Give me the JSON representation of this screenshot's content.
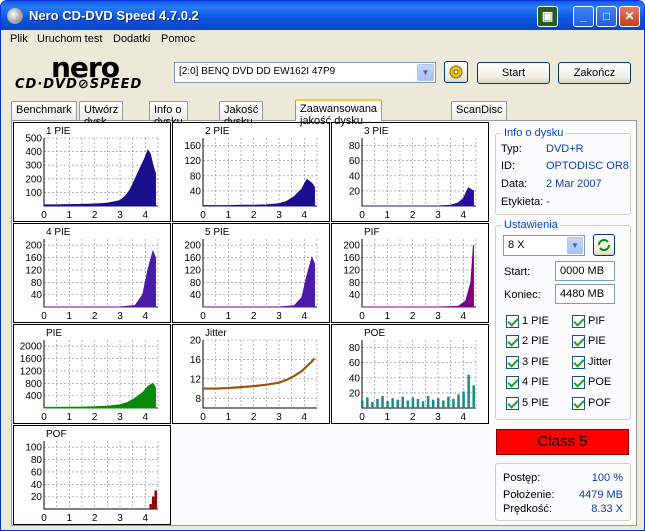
{
  "window": {
    "title": "Nero CD-DVD Speed 4.7.0.2",
    "minimize_label": "_",
    "maximize_label": "□",
    "close_label": "✕"
  },
  "menu": [
    "Plik",
    "Uruchom test",
    "Dodatki",
    "Pomoc"
  ],
  "logo": {
    "brand": "nero",
    "product": "CD·DVD⊘SPEED"
  },
  "toolbar": {
    "drive": "[2:0]   BENQ DVD DD EW162I 47P9",
    "start_label": "Start",
    "exit_label": "Zakończ"
  },
  "tabs": [
    "Benchmark",
    "Utwórz dysk",
    "Info o dysku",
    "Jakość dysku",
    "Zaawansowana jakość dysku",
    "ScanDisc"
  ],
  "active_tab": 4,
  "disc_info": {
    "title": "Info o dysku",
    "type_label": "Typ:",
    "type_value": "DVD+R",
    "id_label": "ID:",
    "id_value": "OPTODISC OR8",
    "date_label": "Data:",
    "date_value": "2 Mar 2007",
    "label_label": "Etykieta:",
    "label_value": "-"
  },
  "settings": {
    "title": "Ustawienia",
    "speed": "8 X",
    "start_label": "Start:",
    "start_value": "0000 MB",
    "end_label": "Koniec:",
    "end_value": "4480 MB",
    "checks": [
      {
        "label": "1 PIE",
        "checked": true
      },
      {
        "label": "PIF",
        "checked": true
      },
      {
        "label": "2 PIE",
        "checked": true
      },
      {
        "label": "PIE",
        "checked": true
      },
      {
        "label": "3 PIE",
        "checked": true
      },
      {
        "label": "Jitter",
        "checked": true
      },
      {
        "label": "4 PIE",
        "checked": true
      },
      {
        "label": "POE",
        "checked": true
      },
      {
        "label": "5 PIE",
        "checked": true
      },
      {
        "label": "POF",
        "checked": true
      }
    ]
  },
  "class_result": {
    "text": "Class 5",
    "color": "#ff0000"
  },
  "progress": {
    "progress_label": "Postęp:",
    "progress_value": "100 %",
    "position_label": "Położenie:",
    "position_value": "4479 MB",
    "speed_label": "Prędkość:",
    "speed_value": "8.33 X"
  },
  "chart_data": [
    {
      "type": "area",
      "title": "1 PIE",
      "color": "#1a0f8c",
      "yticks": [
        "500",
        "400",
        "300",
        "200",
        "100"
      ],
      "ylim": [
        0,
        500
      ],
      "xticks": [
        "0",
        "1",
        "2",
        "3",
        "4"
      ],
      "xlim": [
        0,
        4.5
      ],
      "x": [
        0,
        0.5,
        1,
        1.5,
        2,
        2.5,
        3,
        3.2,
        3.4,
        3.6,
        3.8,
        4,
        4.1,
        4.2,
        4.3,
        4.4
      ],
      "y": [
        8,
        8,
        10,
        12,
        15,
        20,
        40,
        70,
        120,
        200,
        280,
        360,
        410,
        380,
        300,
        240
      ]
    },
    {
      "type": "area",
      "title": "2 PIE",
      "color": "#1a0f8c",
      "yticks": [
        "160",
        "120",
        "80",
        "40"
      ],
      "ylim": [
        0,
        180
      ],
      "xticks": [
        "0",
        "1",
        "2",
        "3",
        "4"
      ],
      "xlim": [
        0,
        4.5
      ],
      "x": [
        0,
        0.5,
        1,
        1.5,
        2,
        2.5,
        3,
        3.3,
        3.6,
        3.9,
        4.1,
        4.3,
        4.4
      ],
      "y": [
        1,
        1,
        1,
        2,
        2,
        3,
        6,
        12,
        25,
        45,
        70,
        60,
        50
      ]
    },
    {
      "type": "area",
      "title": "3 PIE",
      "color": "#2a0f9c",
      "yticks": [
        "80",
        "60",
        "40",
        "20"
      ],
      "ylim": [
        0,
        90
      ],
      "xticks": [
        "0",
        "1",
        "2",
        "3",
        "4"
      ],
      "xlim": [
        0,
        4.5
      ],
      "x": [
        0,
        1,
        2,
        3,
        3.5,
        3.8,
        4,
        4.2,
        4.4
      ],
      "y": [
        0,
        0,
        0,
        0,
        1,
        4,
        10,
        24,
        20
      ]
    },
    {
      "type": "area",
      "title": "4 PIE",
      "color": "#4a1aa8",
      "yticks": [
        "200",
        "160",
        "120",
        "80",
        "40"
      ],
      "ylim": [
        0,
        220
      ],
      "xticks": [
        "0",
        "1",
        "2",
        "3",
        "4"
      ],
      "xlim": [
        0,
        4.5
      ],
      "x": [
        0,
        1,
        2,
        3,
        3.6,
        3.9,
        4.1,
        4.3,
        4.4
      ],
      "y": [
        0,
        0,
        0,
        0,
        5,
        40,
        120,
        180,
        160
      ]
    },
    {
      "type": "area",
      "title": "5 PIE",
      "color": "#4a1aa8",
      "yticks": [
        "200",
        "160",
        "120",
        "80",
        "40"
      ],
      "ylim": [
        0,
        220
      ],
      "xticks": [
        "0",
        "1",
        "2",
        "3",
        "4"
      ],
      "xlim": [
        0,
        4.5
      ],
      "x": [
        0,
        1,
        2,
        3,
        3.6,
        3.9,
        4.1,
        4.3,
        4.4
      ],
      "y": [
        0,
        0,
        0,
        0,
        4,
        30,
        100,
        160,
        140
      ]
    },
    {
      "type": "area",
      "title": "PIF",
      "color": "#800080",
      "yticks": [
        "200",
        "160",
        "120",
        "80",
        "40"
      ],
      "ylim": [
        0,
        220
      ],
      "xticks": [
        "0",
        "1",
        "2",
        "3",
        "4"
      ],
      "xlim": [
        0,
        4.5
      ],
      "x": [
        0,
        1,
        2,
        3,
        3.8,
        4.1,
        4.3,
        4.4
      ],
      "y": [
        0,
        0,
        0,
        0,
        2,
        20,
        80,
        200
      ]
    },
    {
      "type": "area",
      "title": "PIE",
      "color": "#0a8a0a",
      "yticks": [
        "2000",
        "1600",
        "1200",
        "800",
        "400"
      ],
      "ylim": [
        0,
        2200
      ],
      "xticks": [
        "0",
        "1",
        "2",
        "3",
        "4"
      ],
      "xlim": [
        0,
        4.5
      ],
      "x": [
        0,
        0.5,
        1,
        1.5,
        2,
        2.5,
        3,
        3.3,
        3.6,
        3.9,
        4.1,
        4.3,
        4.4
      ],
      "y": [
        20,
        20,
        25,
        30,
        40,
        60,
        100,
        180,
        320,
        500,
        700,
        800,
        650
      ]
    },
    {
      "type": "line",
      "title": "Jitter",
      "color": "#a0500a",
      "yticks": [
        "20",
        "16",
        "12",
        "8"
      ],
      "ylim": [
        6,
        20
      ],
      "xticks": [
        "0",
        "1",
        "2",
        "3",
        "4"
      ],
      "xlim": [
        0,
        4.5
      ],
      "x": [
        0,
        0.5,
        1,
        1.5,
        2,
        2.5,
        3,
        3.3,
        3.6,
        3.9,
        4.1,
        4.3,
        4.4
      ],
      "y": [
        10,
        10,
        10.1,
        10.3,
        10.5,
        10.8,
        11.2,
        11.8,
        12.6,
        13.6,
        14.6,
        15.6,
        16.2
      ]
    },
    {
      "type": "bar",
      "title": "POE",
      "color": "#1a8a8a",
      "yticks": [
        "80",
        "60",
        "40",
        "20"
      ],
      "ylim": [
        0,
        90
      ],
      "xticks": [
        "0",
        "1",
        "2",
        "3",
        "4"
      ],
      "xlim": [
        0,
        4.5
      ],
      "x": [
        0,
        0.2,
        0.4,
        0.6,
        0.8,
        1,
        1.2,
        1.4,
        1.6,
        1.8,
        2,
        2.2,
        2.4,
        2.6,
        2.8,
        3,
        3.2,
        3.4,
        3.6,
        3.8,
        4,
        4.2,
        4.4
      ],
      "y": [
        10,
        14,
        8,
        12,
        16,
        9,
        13,
        11,
        15,
        10,
        14,
        12,
        9,
        16,
        11,
        13,
        10,
        15,
        12,
        18,
        22,
        44,
        30
      ]
    },
    {
      "type": "bar",
      "title": "POF",
      "color": "#8a0a0a",
      "yticks": [
        "100",
        "80",
        "60",
        "40",
        "20"
      ],
      "ylim": [
        0,
        110
      ],
      "xticks": [
        "0",
        "1",
        "2",
        "3",
        "4"
      ],
      "xlim": [
        0,
        4.5
      ],
      "x": [
        0,
        1,
        2,
        3,
        4,
        4.2,
        4.3,
        4.4
      ],
      "y": [
        0,
        0,
        0,
        0,
        0,
        8,
        20,
        30
      ]
    }
  ]
}
